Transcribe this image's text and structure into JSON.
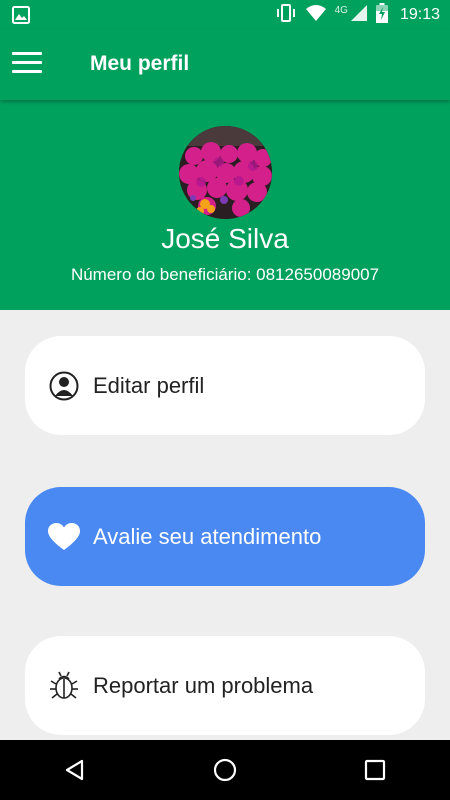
{
  "status_bar": {
    "time": "19:13",
    "network": "4G",
    "icons": [
      "image-icon",
      "vibrate-icon",
      "wifi-icon",
      "signal-icon",
      "battery-icon"
    ]
  },
  "app_bar": {
    "title": "Meu perfil",
    "menu_icon": "hamburger-menu-icon"
  },
  "profile": {
    "name": "José Silva",
    "beneficiary": "Número do beneficiário: 0812650089007"
  },
  "actions": [
    {
      "label": "Editar perfil",
      "icon": "user-icon"
    },
    {
      "label": "Avalie seu atendimento",
      "icon": "heart-icon"
    },
    {
      "label": "Reportar um problema",
      "icon": "bug-icon"
    }
  ],
  "colors": {
    "primary": "#00a05d",
    "accent_card": "#4a88f2",
    "background": "#eeeeee"
  },
  "nav_bar": {
    "icons": [
      "back-icon",
      "home-icon",
      "recents-icon"
    ]
  }
}
